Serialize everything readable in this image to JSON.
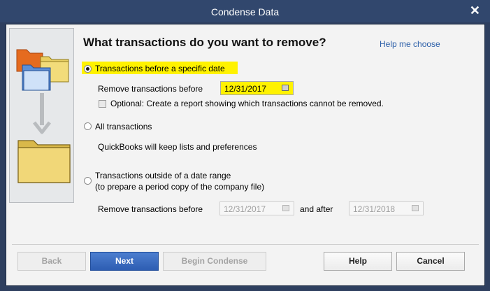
{
  "window": {
    "title": "Condense Data"
  },
  "heading": "What transactions do you want to remove?",
  "help_link": "Help me choose",
  "option_specific": {
    "label": "Transactions before a specific date",
    "remove_label": "Remove transactions before",
    "date": "12/31/2017",
    "optional_report_label": "Optional: Create a report showing which transactions cannot be removed."
  },
  "option_all": {
    "label": "All transactions",
    "note": "QuickBooks will keep lists and preferences"
  },
  "option_range": {
    "label": "Transactions outside of a date range",
    "sublabel": "(to prepare a period copy of the company file)",
    "remove_label": "Remove transactions before",
    "before_date": "12/31/2017",
    "after_label": "and after",
    "after_date": "12/31/2018"
  },
  "buttons": {
    "back": "Back",
    "next": "Next",
    "begin": "Begin Condense",
    "help": "Help",
    "cancel": "Cancel"
  },
  "colors": {
    "highlight": "#fff200",
    "link": "#2b5ea8",
    "titlebar": "#31476d",
    "primary_button": "#2d5db2"
  }
}
